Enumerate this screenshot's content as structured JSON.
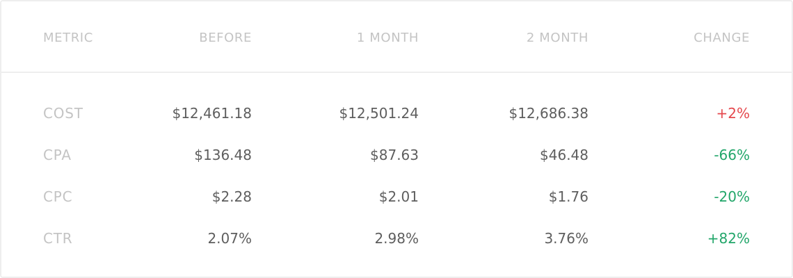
{
  "table": {
    "headers": {
      "metric": "METRIC",
      "before": "BEFORE",
      "month1": "1 MONTH",
      "month2": "2 MONTH",
      "change": "CHANGE"
    },
    "rows": [
      {
        "metric": "COST",
        "before": "$12,461.18",
        "month1": "$12,501.24",
        "month2": "$12,686.38",
        "change": "+2%",
        "change_direction": "up",
        "change_color": "#e5484d"
      },
      {
        "metric": "CPA",
        "before": "$136.48",
        "month1": "$87.63",
        "month2": "$46.48",
        "change": "-66%",
        "change_direction": "down",
        "change_color": "#22a66a"
      },
      {
        "metric": "CPC",
        "before": "$2.28",
        "month1": "$2.01",
        "month2": "$1.76",
        "change": "-20%",
        "change_direction": "down",
        "change_color": "#22a66a"
      },
      {
        "metric": "CTR",
        "before": "2.07%",
        "month1": "2.98%",
        "month2": "3.76%",
        "change": "+82%",
        "change_direction": "up",
        "change_color": "#22a66a"
      }
    ]
  }
}
